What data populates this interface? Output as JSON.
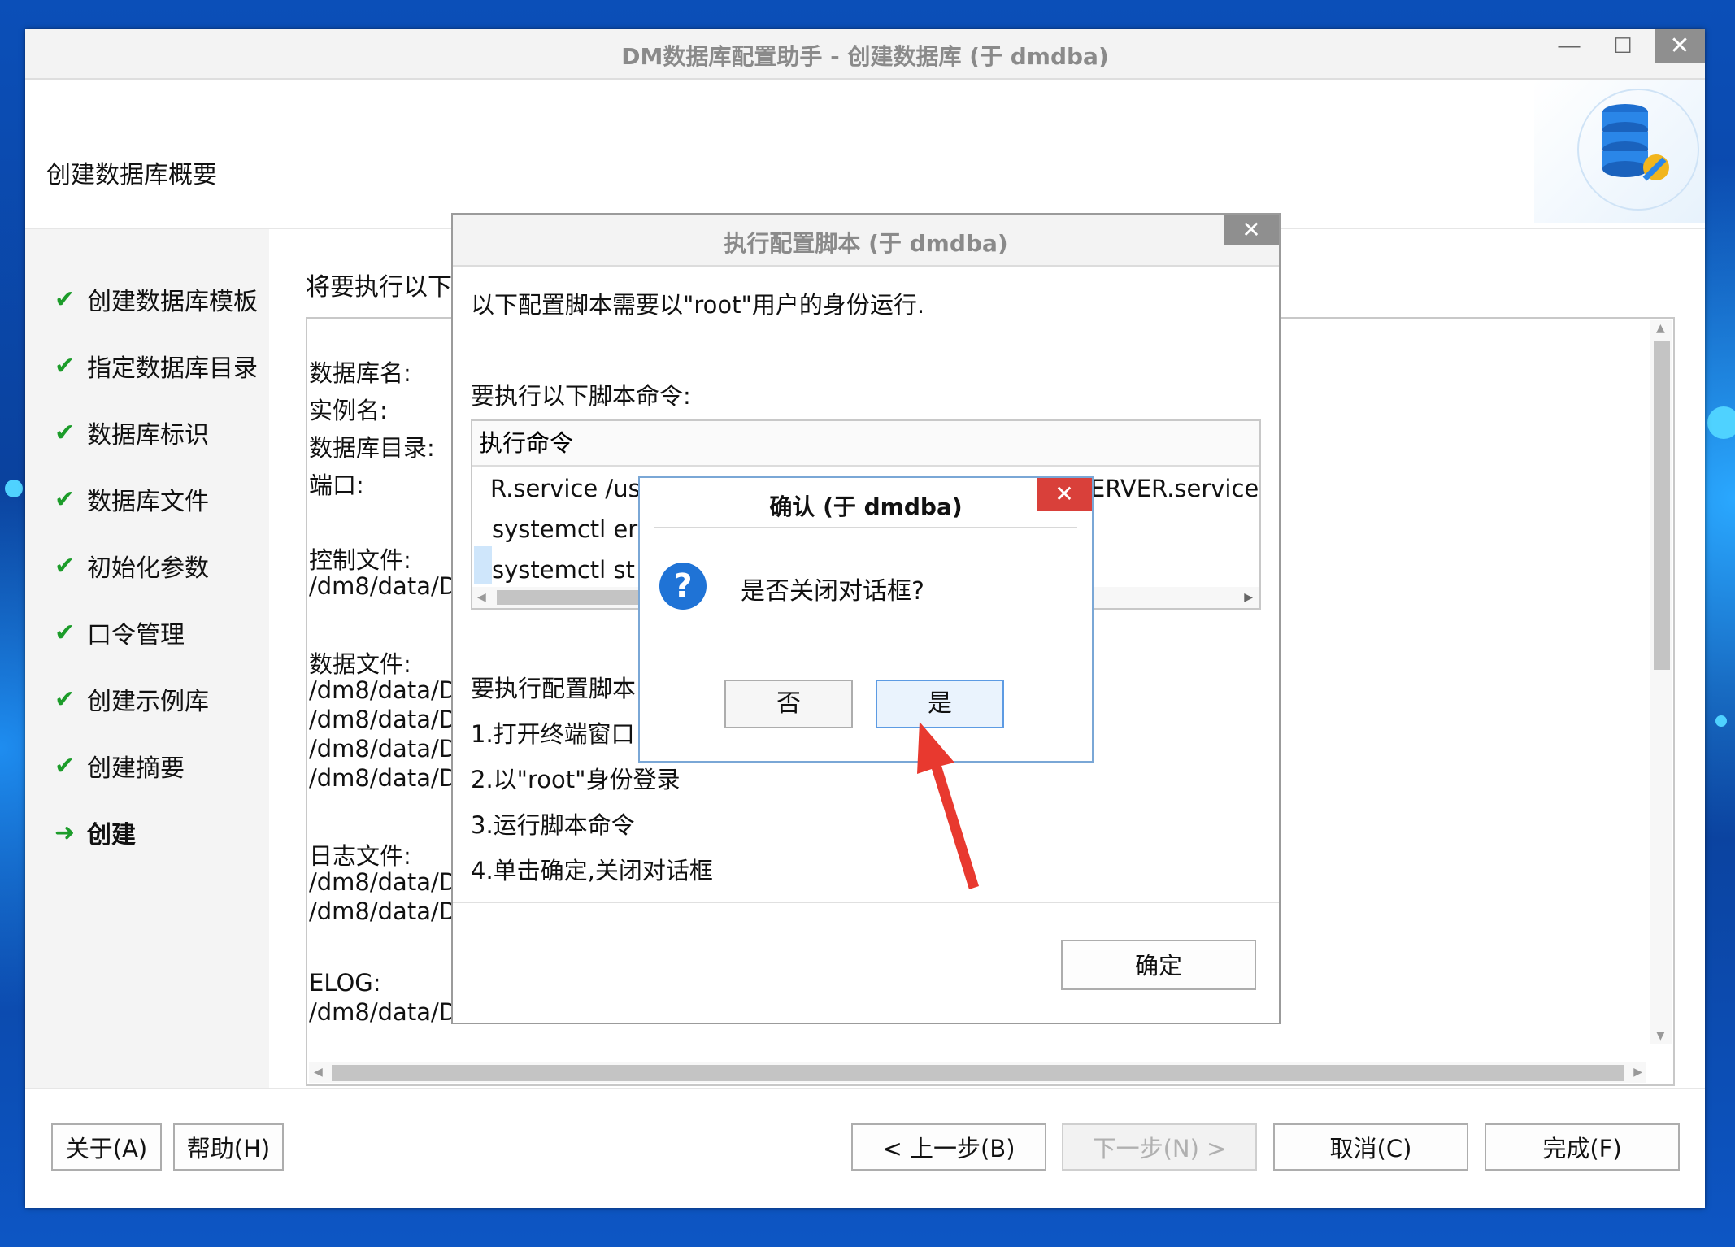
{
  "window": {
    "title": "DM数据库配置助手 - 创建数据库 (于 dmdba)",
    "minimize_glyph": "—",
    "maximize_glyph": "☐",
    "close_glyph": "✕"
  },
  "header": {
    "title": "创建数据库概要",
    "art_icon": "database-settings-icon"
  },
  "sidebar": {
    "items": [
      {
        "label": "创建数据库模板",
        "mark": "✔"
      },
      {
        "label": "指定数据库目录",
        "mark": "✔"
      },
      {
        "label": "数据库标识",
        "mark": "✔"
      },
      {
        "label": "数据库文件",
        "mark": "✔"
      },
      {
        "label": "初始化参数",
        "mark": "✔"
      },
      {
        "label": "口令管理",
        "mark": "✔"
      },
      {
        "label": "创建示例库",
        "mark": "✔"
      },
      {
        "label": "创建摘要",
        "mark": "✔"
      },
      {
        "label": "创建",
        "mark": "➜"
      }
    ]
  },
  "main": {
    "label": "将要执行以下",
    "summary_lines": [
      "数据库名:",
      "实例名:",
      "数据库目录:",
      "端口:",
      "控制文件:",
      "/dm8/data/D",
      "数据文件:",
      "/dm8/data/D",
      "/dm8/data/D",
      "/dm8/data/D",
      "/dm8/data/D",
      "日志文件:",
      "/dm8/data/D",
      "/dm8/data/D",
      "ELOG:",
      "/dm8/data/D"
    ]
  },
  "footer": {
    "about": "关于(A)",
    "help": "帮助(H)",
    "prev": "< 上一步(B)",
    "next": "下一步(N) >",
    "cancel": "取消(C)",
    "finish": "完成(F)"
  },
  "script_dialog": {
    "title": "执行配置脚本 (于 dmdba)",
    "close_glyph": "✕",
    "intro": "以下配置脚本需要以\"root\"用户的身份运行.",
    "commands_label": "要执行以下脚本命令:",
    "column_header": "执行命令",
    "commands": [
      "R.service /us",
      "systemctl er",
      "systemctl st"
    ],
    "command_tail": "ERVER.service",
    "steps_label": "要执行配置脚本",
    "steps": [
      "1.打开终端窗口",
      "2.以\"root\"身份登录",
      "3.运行脚本命令",
      "4.单击确定,关闭对话框"
    ],
    "ok": "确定"
  },
  "confirm_dialog": {
    "title": "确认  (于 dmdba)",
    "close_glyph": "✕",
    "icon_glyph": "?",
    "message": "是否关闭对话框?",
    "no": "否",
    "yes": "是"
  },
  "colors": {
    "accent": "#1f73d6",
    "close_red": "#d9403a",
    "check_green": "#1c9c2a",
    "annotation_arrow": "#e8392f"
  }
}
